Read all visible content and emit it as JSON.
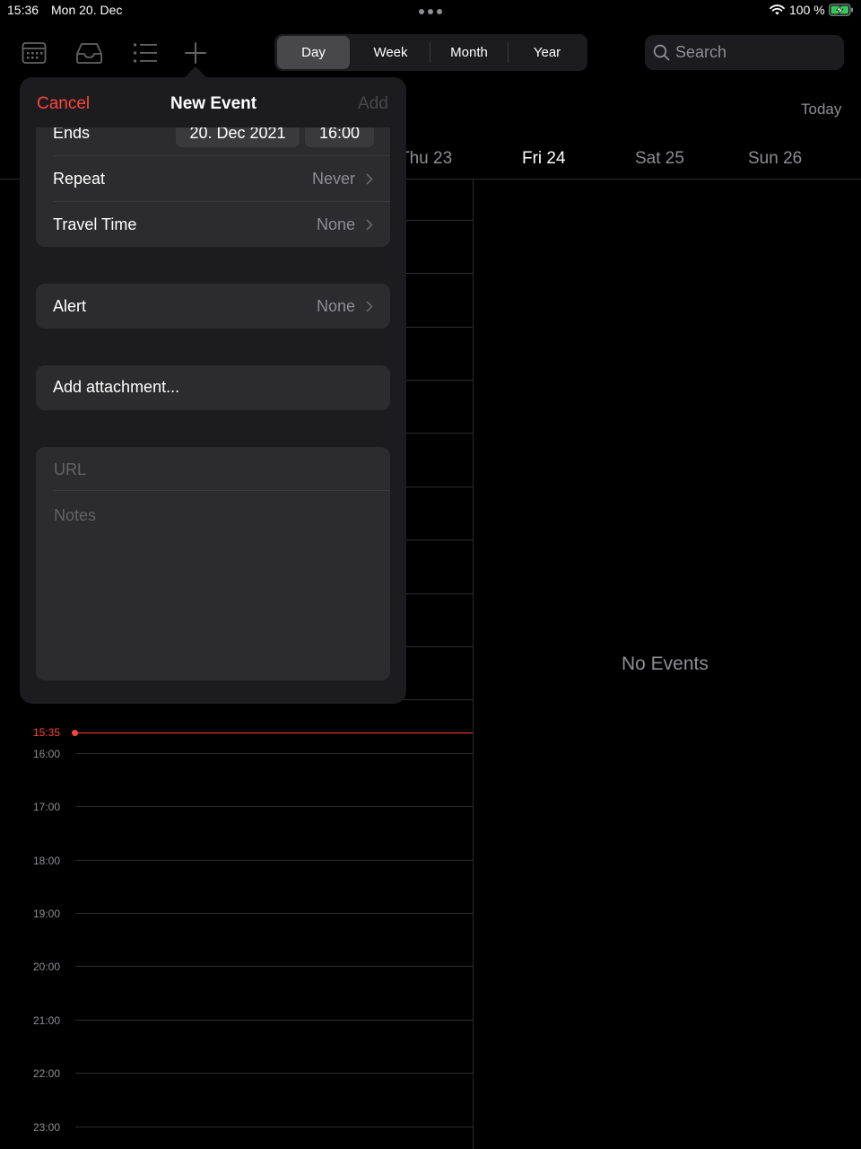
{
  "status": {
    "time": "15:36",
    "date": "Mon 20. Dec",
    "battery": "100 %"
  },
  "toolbar": {
    "icons": [
      "calendars-icon",
      "inbox-icon",
      "list-icon",
      "add-icon"
    ]
  },
  "view_modes": {
    "options": [
      "Day",
      "Week",
      "Month",
      "Year"
    ],
    "selected": "Day"
  },
  "search": {
    "placeholder": "Search"
  },
  "today_button": "Today",
  "week_days": [
    "Thu 23",
    "Fri 24",
    "Sat 25",
    "Sun 26"
  ],
  "current_day": "Fri 24",
  "timeline": {
    "hours": [
      "16:00",
      "17:00",
      "18:00",
      "19:00",
      "20:00",
      "21:00",
      "22:00",
      "23:00"
    ],
    "now": "15:35"
  },
  "no_events": "No Events",
  "new_event": {
    "cancel": "Cancel",
    "title": "New Event",
    "add": "Add",
    "ends_label": "Ends",
    "ends_date": "20. Dec 2021",
    "ends_time": "16:00",
    "repeat_label": "Repeat",
    "repeat_value": "Never",
    "travel_label": "Travel Time",
    "travel_value": "None",
    "alert_label": "Alert",
    "alert_value": "None",
    "attachment_label": "Add attachment...",
    "url_placeholder": "URL",
    "notes_placeholder": "Notes"
  },
  "colors": {
    "accent_red": "#ff453a",
    "background": "#000000",
    "panel": "#1c1c1e",
    "row": "#2c2c2e",
    "secondary_text": "#8e8e93"
  }
}
